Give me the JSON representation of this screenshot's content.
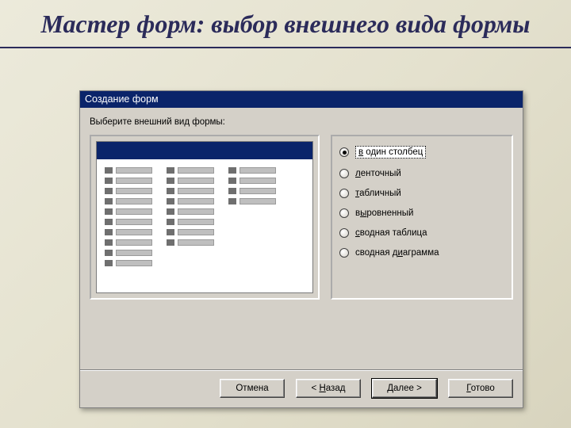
{
  "slide": {
    "title": "Мастер форм: выбор внешнего вида формы"
  },
  "dialog": {
    "title": "Создание форм",
    "instruction": "Выберите внешний вид формы:",
    "options": {
      "0": {
        "pre": "",
        "u": "в",
        "post": " один столбец"
      },
      "1": {
        "pre": "",
        "u": "л",
        "post": "енточный"
      },
      "2": {
        "pre": "",
        "u": "т",
        "post": "абличный"
      },
      "3": {
        "pre": "в",
        "u": "ы",
        "post": "ровненный"
      },
      "4": {
        "pre": "",
        "u": "с",
        "post": "водная таблица"
      },
      "5": {
        "pre": "сводная д",
        "u": "и",
        "post": "аграмма"
      }
    },
    "buttons": {
      "cancel": "Отмена",
      "back_pre": "< ",
      "back_u": "Н",
      "back_post": "азад",
      "next_u": "Д",
      "next_post": "алее >",
      "finish_u": "Г",
      "finish_post": "отово"
    }
  }
}
